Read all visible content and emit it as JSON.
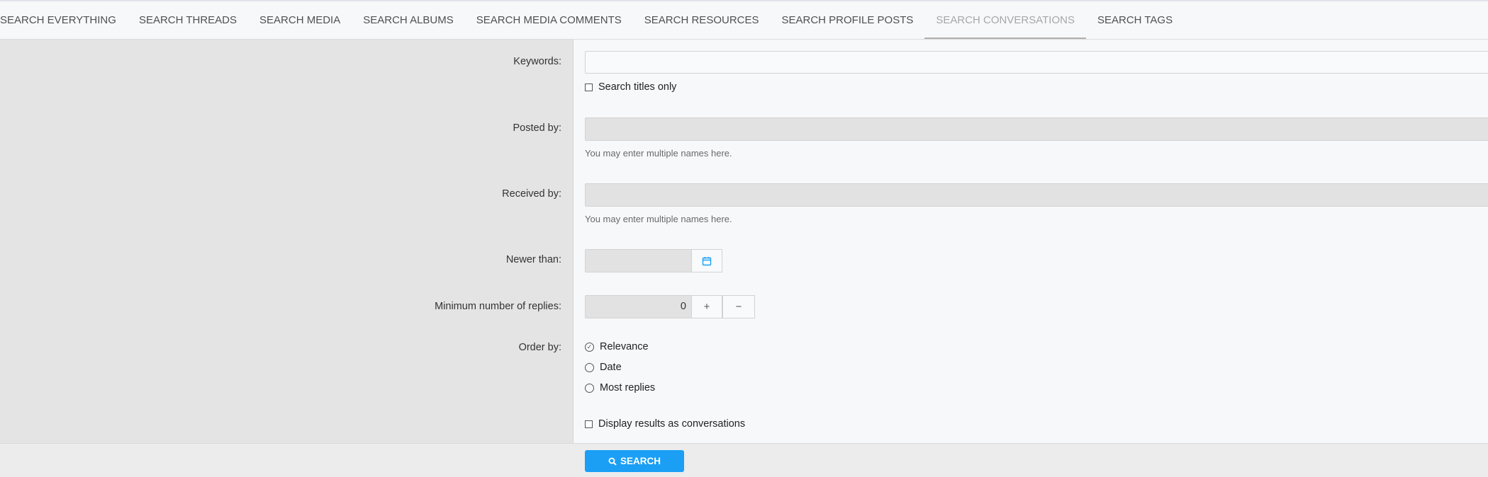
{
  "tabs": [
    {
      "label": "SEARCH EVERYTHING"
    },
    {
      "label": "SEARCH THREADS"
    },
    {
      "label": "SEARCH MEDIA"
    },
    {
      "label": "SEARCH ALBUMS"
    },
    {
      "label": "SEARCH MEDIA COMMENTS"
    },
    {
      "label": "SEARCH RESOURCES"
    },
    {
      "label": "SEARCH PROFILE POSTS"
    },
    {
      "label": "SEARCH CONVERSATIONS",
      "active": true
    },
    {
      "label": "SEARCH TAGS"
    }
  ],
  "form": {
    "keywords_label": "Keywords:",
    "keywords_value": "",
    "titles_only_label": "Search titles only",
    "posted_by_label": "Posted by:",
    "posted_by_hint": "You may enter multiple names here.",
    "received_by_label": "Received by:",
    "received_by_hint": "You may enter multiple names here.",
    "newer_than_label": "Newer than:",
    "min_replies_label": "Minimum number of replies:",
    "min_replies_value": "0",
    "plus_symbol": "+",
    "minus_symbol": "−",
    "order_by_label": "Order by:",
    "order_options": [
      "Relevance",
      "Date",
      "Most replies"
    ],
    "order_selected": "Relevance",
    "display_as_conversations_label": "Display results as conversations",
    "submit_label": "SEARCH"
  },
  "icons": {
    "calendar": "calendar-icon",
    "search": "search-icon"
  },
  "colors": {
    "accent": "#1a9ff5",
    "calendar_icon": "#1a9ff5"
  }
}
